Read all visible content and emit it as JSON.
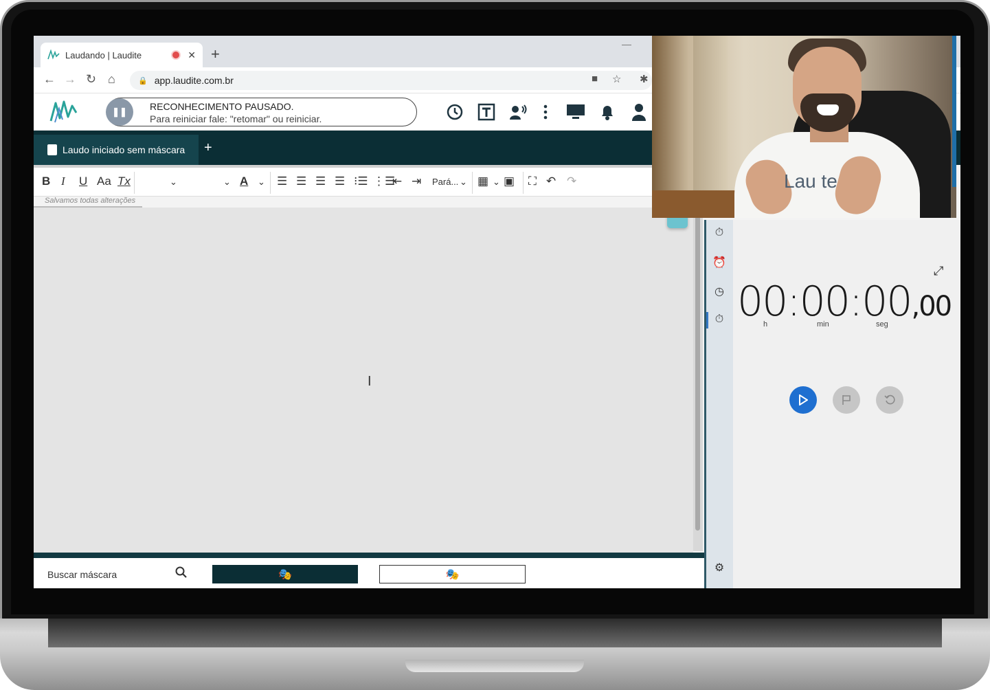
{
  "browser": {
    "tab_title": "Laudando | Laudite",
    "new_tab_symbol": "+",
    "close_symbol": "✕",
    "url": "app.laudite.com.br",
    "minimize_symbol": "—"
  },
  "header": {
    "recognition_title": "RECONHECIMENTO PAUSADO.",
    "recognition_hint": "Para reiniciar fale: \"retomar\" ou reiniciar.",
    "pause_symbol": "❚❚",
    "icons": [
      "history-icon",
      "text-template-icon",
      "voice-command-icon",
      "more-vert-icon",
      "monitor-icon",
      "notification-bell-icon",
      "user-icon"
    ]
  },
  "document_tabs": {
    "active_tab_label": "Laudo iniciado sem máscara",
    "add_symbol": "+"
  },
  "toolbar": {
    "bold": "B",
    "italic": "I",
    "underline": "U",
    "font_case": "Aa",
    "clear_format": "Tx",
    "font_color": "A",
    "paragraph": "Pará...",
    "saved_status": "Salvamos todas alterações"
  },
  "bottom_bar": {
    "search_placeholder": "Buscar máscara",
    "mask_icon": "🎭"
  },
  "stopwatch": {
    "value_main": "00:00:00",
    "value_frac": ",00",
    "label_h": "h",
    "label_min": "min",
    "label_seg": "seg"
  },
  "webcam": {
    "shirt_text": "Lau  te"
  },
  "colors": {
    "dark_teal": "#0b2e35",
    "accent_blue": "#1f6fd0",
    "recording_red": "#e24c4c"
  }
}
